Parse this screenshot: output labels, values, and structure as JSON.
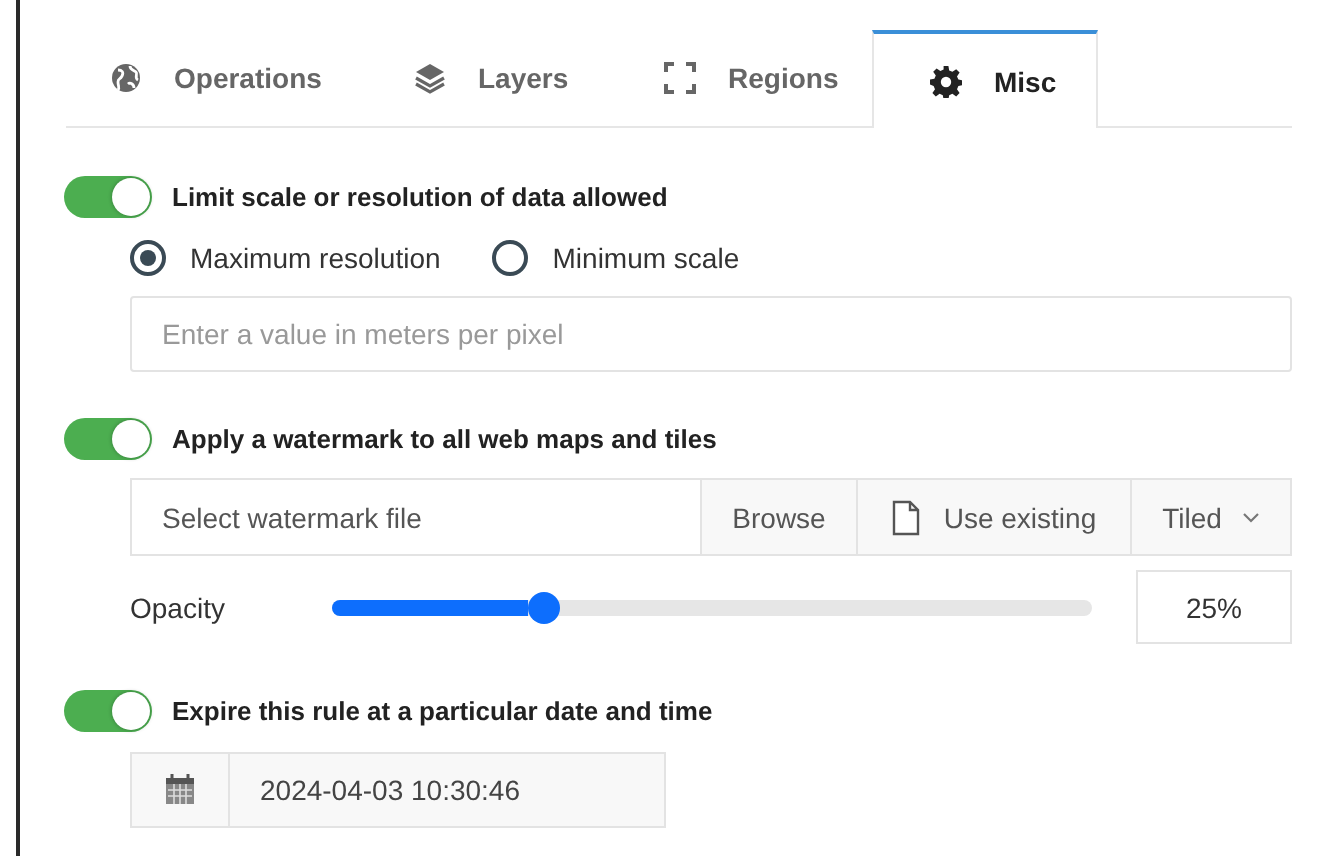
{
  "tabs": [
    {
      "label": "Operations",
      "selected": false
    },
    {
      "label": "Layers",
      "selected": false
    },
    {
      "label": "Regions",
      "selected": false
    },
    {
      "label": "Misc",
      "selected": true
    }
  ],
  "sections": [
    {
      "kind": "resolution",
      "enabled": true,
      "label": "Limit scale or resolution of data allowed",
      "options": [
        {
          "label": "Maximum resolution",
          "selected": true
        },
        {
          "label": "Minimum scale",
          "selected": false
        }
      ],
      "input": {
        "placeholder": "Enter a value in meters per pixel"
      }
    },
    {
      "kind": "watermark",
      "enabled": true,
      "label": "Apply a watermark to all web maps and tiles",
      "file_field": {
        "placeholder": "Select watermark file"
      },
      "browse_button": "Browse",
      "use_existing_button": "Use existing",
      "mode_dropdown": "Tiled",
      "opacity": {
        "label": "Opacity",
        "level": 0.28,
        "reading": "25%"
      }
    },
    {
      "kind": "expiry",
      "enabled": true,
      "label": "Expire this rule at a particular date and time",
      "date_field": {
        "value": "2024-04-03 10:30:46"
      }
    }
  ]
}
